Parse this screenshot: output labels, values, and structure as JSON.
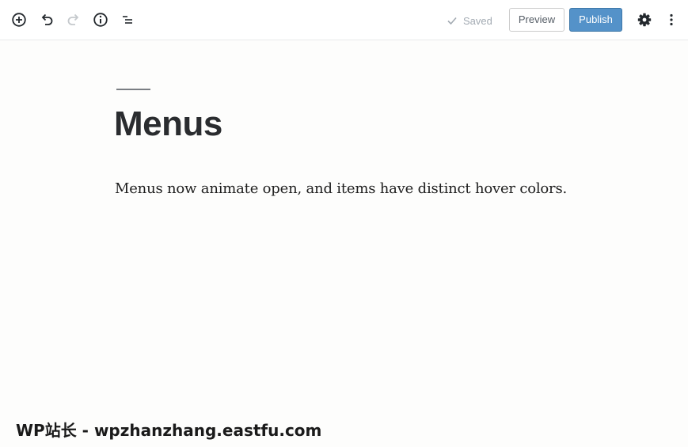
{
  "toolbar": {
    "icons": {
      "add": "plus-circle-icon",
      "undo": "undo-icon",
      "redo": "redo-icon",
      "info": "info-icon",
      "outline": "list-view-icon",
      "settings": "gear-icon",
      "more": "more-vertical-icon"
    },
    "saved_label": "Saved",
    "preview_label": "Preview",
    "publish_label": "Publish",
    "colors": {
      "publish_bg": "#5492c9",
      "saved_text": "#a2aab2"
    }
  },
  "post": {
    "title": "Menus",
    "paragraph": "Menus now animate open, and items have distinct hover colors."
  },
  "watermark": {
    "text": "WP站长 - wpzhanzhang.eastfu.com"
  }
}
